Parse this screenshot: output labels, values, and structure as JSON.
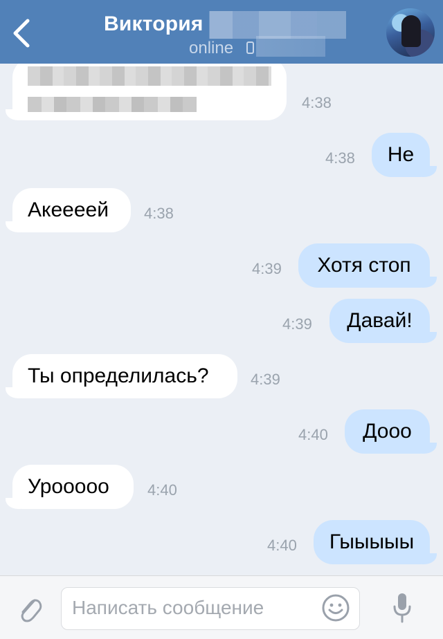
{
  "header": {
    "back_icon": "chevron-left-icon",
    "title": "Виктория",
    "status": "online",
    "status_icon": "mobile-icon",
    "avatar": "avatar"
  },
  "messages": [
    {
      "dir": "in",
      "text": "",
      "time": "4:38"
    },
    {
      "dir": "out",
      "text": "Не",
      "time": "4:38"
    },
    {
      "dir": "in",
      "text": "Акеееей",
      "time": "4:38"
    },
    {
      "dir": "out",
      "text": "Хотя стоп",
      "time": "4:39"
    },
    {
      "dir": "out",
      "text": "Давай!",
      "time": "4:39"
    },
    {
      "dir": "in",
      "text": "Ты определилась?",
      "time": "4:39"
    },
    {
      "dir": "out",
      "text": "Дооо",
      "time": "4:40"
    },
    {
      "dir": "in",
      "text": "Урооооо",
      "time": "4:40"
    },
    {
      "dir": "out",
      "text": "Гыыыыы",
      "time": "4:40"
    }
  ],
  "composer": {
    "placeholder": "Написать сообщение",
    "attach_icon": "paperclip-icon",
    "emoji_icon": "smile-icon",
    "mic_icon": "microphone-icon"
  },
  "colors": {
    "header_bg": "#5181b8",
    "chat_bg": "#ebeff5",
    "incoming_bubble": "#ffffff",
    "outgoing_bubble": "#cce4ff"
  }
}
